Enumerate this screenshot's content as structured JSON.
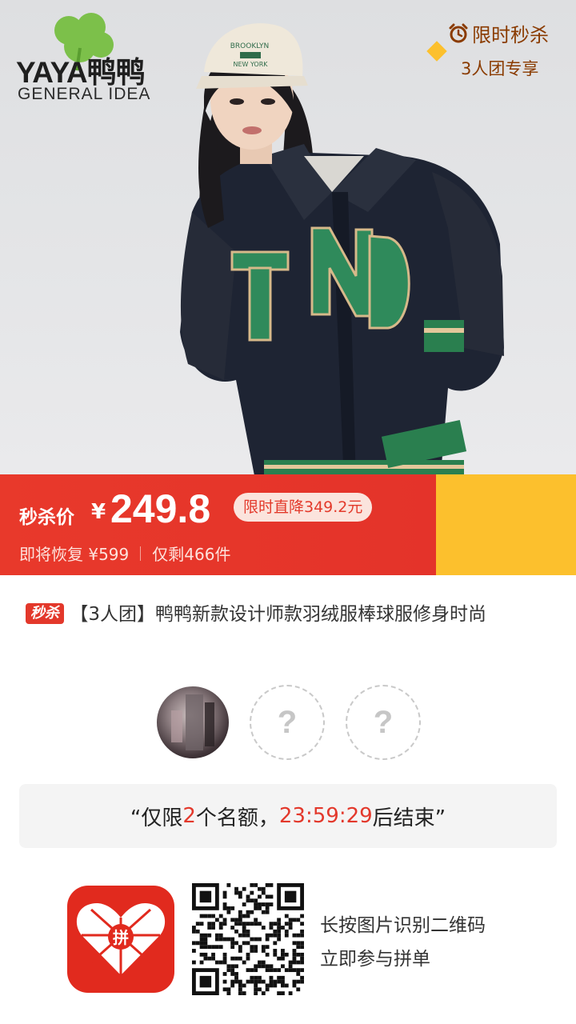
{
  "brand": {
    "logo_text": "YAYA鸭鸭",
    "tagline": "GENERAL IDEA"
  },
  "product_image": {
    "patch_text": "T ND",
    "cap_text": "BROOKLYN NEW YORK"
  },
  "price_banner": {
    "seckill_label": "秒杀价",
    "currency": "¥",
    "price": "249.8",
    "drop_badge": "限时直降349.2元",
    "restore_text": "即将恢复 ¥599",
    "remaining_text": "仅剩466件",
    "limited_title": "限时秒杀",
    "limited_sub": "3人团专享",
    "colors": {
      "red": "#e4332a",
      "yellow": "#fcc02d",
      "brown": "#8a3b00"
    }
  },
  "product": {
    "tag": "秒杀",
    "title": "【3人团】鸭鸭新款设计师款羽绒服棒球服修身时尚"
  },
  "group": {
    "empty_slot_symbol": "?",
    "quota_open": "“仅限",
    "quota_count": "2",
    "quota_mid": "个名额，",
    "quota_time": "23:59:29",
    "quota_close": "后结束”"
  },
  "promo": {
    "app_icon_label": "拼",
    "line1": "长按图片识别二维码",
    "line2": "立即参与拼单"
  }
}
